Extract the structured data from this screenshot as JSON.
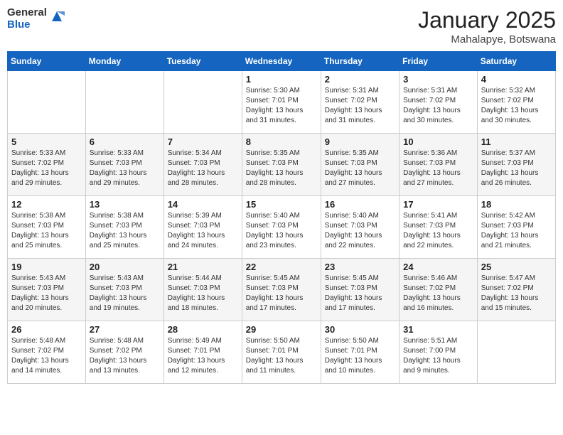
{
  "logo": {
    "general": "General",
    "blue": "Blue"
  },
  "header": {
    "month": "January 2025",
    "location": "Mahalapye, Botswana"
  },
  "days_of_week": [
    "Sunday",
    "Monday",
    "Tuesday",
    "Wednesday",
    "Thursday",
    "Friday",
    "Saturday"
  ],
  "weeks": [
    [
      {
        "day": "",
        "info": ""
      },
      {
        "day": "",
        "info": ""
      },
      {
        "day": "",
        "info": ""
      },
      {
        "day": "1",
        "info": "Sunrise: 5:30 AM\nSunset: 7:01 PM\nDaylight: 13 hours\nand 31 minutes."
      },
      {
        "day": "2",
        "info": "Sunrise: 5:31 AM\nSunset: 7:02 PM\nDaylight: 13 hours\nand 31 minutes."
      },
      {
        "day": "3",
        "info": "Sunrise: 5:31 AM\nSunset: 7:02 PM\nDaylight: 13 hours\nand 30 minutes."
      },
      {
        "day": "4",
        "info": "Sunrise: 5:32 AM\nSunset: 7:02 PM\nDaylight: 13 hours\nand 30 minutes."
      }
    ],
    [
      {
        "day": "5",
        "info": "Sunrise: 5:33 AM\nSunset: 7:02 PM\nDaylight: 13 hours\nand 29 minutes."
      },
      {
        "day": "6",
        "info": "Sunrise: 5:33 AM\nSunset: 7:03 PM\nDaylight: 13 hours\nand 29 minutes."
      },
      {
        "day": "7",
        "info": "Sunrise: 5:34 AM\nSunset: 7:03 PM\nDaylight: 13 hours\nand 28 minutes."
      },
      {
        "day": "8",
        "info": "Sunrise: 5:35 AM\nSunset: 7:03 PM\nDaylight: 13 hours\nand 28 minutes."
      },
      {
        "day": "9",
        "info": "Sunrise: 5:35 AM\nSunset: 7:03 PM\nDaylight: 13 hours\nand 27 minutes."
      },
      {
        "day": "10",
        "info": "Sunrise: 5:36 AM\nSunset: 7:03 PM\nDaylight: 13 hours\nand 27 minutes."
      },
      {
        "day": "11",
        "info": "Sunrise: 5:37 AM\nSunset: 7:03 PM\nDaylight: 13 hours\nand 26 minutes."
      }
    ],
    [
      {
        "day": "12",
        "info": "Sunrise: 5:38 AM\nSunset: 7:03 PM\nDaylight: 13 hours\nand 25 minutes."
      },
      {
        "day": "13",
        "info": "Sunrise: 5:38 AM\nSunset: 7:03 PM\nDaylight: 13 hours\nand 25 minutes."
      },
      {
        "day": "14",
        "info": "Sunrise: 5:39 AM\nSunset: 7:03 PM\nDaylight: 13 hours\nand 24 minutes."
      },
      {
        "day": "15",
        "info": "Sunrise: 5:40 AM\nSunset: 7:03 PM\nDaylight: 13 hours\nand 23 minutes."
      },
      {
        "day": "16",
        "info": "Sunrise: 5:40 AM\nSunset: 7:03 PM\nDaylight: 13 hours\nand 22 minutes."
      },
      {
        "day": "17",
        "info": "Sunrise: 5:41 AM\nSunset: 7:03 PM\nDaylight: 13 hours\nand 22 minutes."
      },
      {
        "day": "18",
        "info": "Sunrise: 5:42 AM\nSunset: 7:03 PM\nDaylight: 13 hours\nand 21 minutes."
      }
    ],
    [
      {
        "day": "19",
        "info": "Sunrise: 5:43 AM\nSunset: 7:03 PM\nDaylight: 13 hours\nand 20 minutes."
      },
      {
        "day": "20",
        "info": "Sunrise: 5:43 AM\nSunset: 7:03 PM\nDaylight: 13 hours\nand 19 minutes."
      },
      {
        "day": "21",
        "info": "Sunrise: 5:44 AM\nSunset: 7:03 PM\nDaylight: 13 hours\nand 18 minutes."
      },
      {
        "day": "22",
        "info": "Sunrise: 5:45 AM\nSunset: 7:03 PM\nDaylight: 13 hours\nand 17 minutes."
      },
      {
        "day": "23",
        "info": "Sunrise: 5:45 AM\nSunset: 7:03 PM\nDaylight: 13 hours\nand 17 minutes."
      },
      {
        "day": "24",
        "info": "Sunrise: 5:46 AM\nSunset: 7:02 PM\nDaylight: 13 hours\nand 16 minutes."
      },
      {
        "day": "25",
        "info": "Sunrise: 5:47 AM\nSunset: 7:02 PM\nDaylight: 13 hours\nand 15 minutes."
      }
    ],
    [
      {
        "day": "26",
        "info": "Sunrise: 5:48 AM\nSunset: 7:02 PM\nDaylight: 13 hours\nand 14 minutes."
      },
      {
        "day": "27",
        "info": "Sunrise: 5:48 AM\nSunset: 7:02 PM\nDaylight: 13 hours\nand 13 minutes."
      },
      {
        "day": "28",
        "info": "Sunrise: 5:49 AM\nSunset: 7:01 PM\nDaylight: 13 hours\nand 12 minutes."
      },
      {
        "day": "29",
        "info": "Sunrise: 5:50 AM\nSunset: 7:01 PM\nDaylight: 13 hours\nand 11 minutes."
      },
      {
        "day": "30",
        "info": "Sunrise: 5:50 AM\nSunset: 7:01 PM\nDaylight: 13 hours\nand 10 minutes."
      },
      {
        "day": "31",
        "info": "Sunrise: 5:51 AM\nSunset: 7:00 PM\nDaylight: 13 hours\nand 9 minutes."
      },
      {
        "day": "",
        "info": ""
      }
    ]
  ]
}
